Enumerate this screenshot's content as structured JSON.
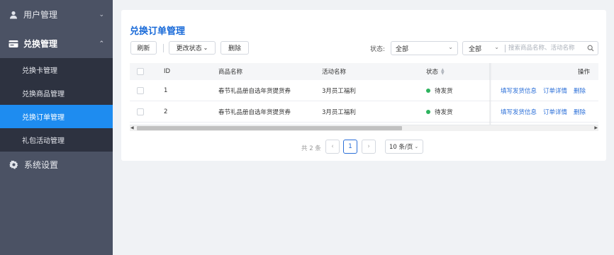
{
  "sidebar": {
    "user_mgmt": {
      "label": "用户管理",
      "icon": "user-icon"
    },
    "exchange_mgmt": {
      "label": "兑换管理",
      "icon": "card-icon",
      "items": [
        {
          "label": "兑换卡管理"
        },
        {
          "label": "兑换商品管理"
        },
        {
          "label": "兑换订单管理"
        },
        {
          "label": "礼包活动管理"
        }
      ]
    },
    "settings": {
      "label": "系统设置",
      "icon": "gear-icon"
    }
  },
  "main": {
    "title": "兑换订单管理",
    "toolbar": {
      "refresh": "刷新",
      "change_status": "更改状态",
      "delete": "删除"
    },
    "filter": {
      "status_label": "状态:",
      "status_value": "全部",
      "search_scope": "全部",
      "search_placeholder": "搜索商品名称、活动名称"
    },
    "table": {
      "headers": {
        "id": "ID",
        "product": "商品名称",
        "activity": "活动名称",
        "status": "状态",
        "actions": "操作"
      },
      "rows": [
        {
          "id": "1",
          "product": "春节礼品册自选年货提货券",
          "activity": "3月员工福利",
          "status": "待发货",
          "a1": "填写发货信息",
          "a2": "订单详情",
          "a3": "删除"
        },
        {
          "id": "2",
          "product": "春节礼品册自选年货提货券",
          "activity": "3月员工福利",
          "status": "待发货",
          "a1": "填写发货信息",
          "a2": "订单详情",
          "a3": "删除"
        }
      ]
    },
    "pagination": {
      "total": "共 2 条",
      "prev": "‹",
      "current": "1",
      "next": "›",
      "page_size": "10 条/页"
    }
  },
  "colors": {
    "sidebar_bg": "#4b5264",
    "submenu_bg": "#2d3240",
    "active": "#1e8cf0",
    "link": "#2b6fd8",
    "status_dot": "#2db35e"
  }
}
